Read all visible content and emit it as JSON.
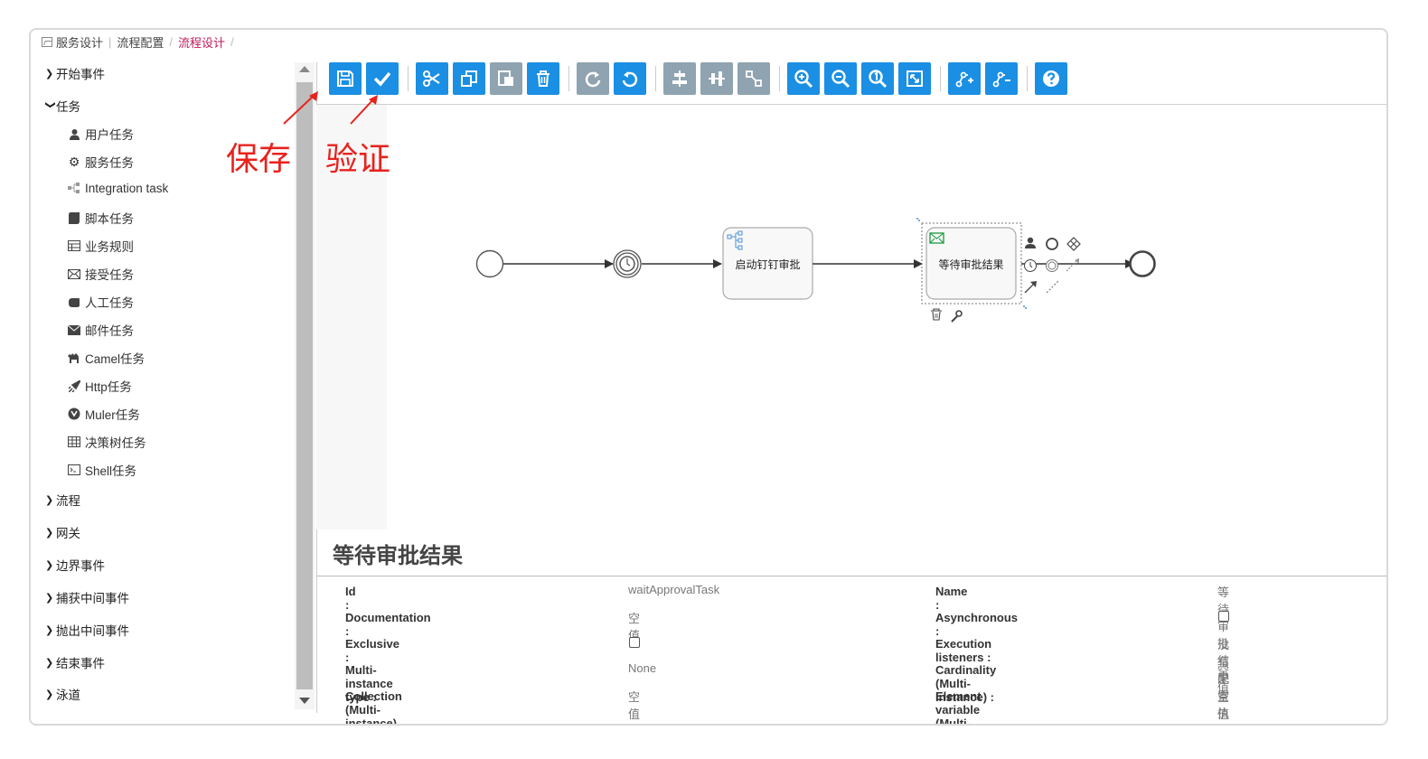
{
  "breadcrumb": {
    "items": [
      "服务设计",
      "流程配置",
      "流程设计"
    ],
    "trailing_sep": "/"
  },
  "palette": {
    "groups": [
      {
        "label": "开始事件",
        "expanded": false
      },
      {
        "label": "任务",
        "expanded": true
      },
      {
        "label": "流程",
        "expanded": false
      },
      {
        "label": "网关",
        "expanded": false
      },
      {
        "label": "边界事件",
        "expanded": false
      },
      {
        "label": "捕获中间事件",
        "expanded": false
      },
      {
        "label": "抛出中间事件",
        "expanded": false
      },
      {
        "label": "结束事件",
        "expanded": false
      },
      {
        "label": "泳道",
        "expanded": false
      }
    ],
    "task_items": [
      {
        "label": "用户任务",
        "icon": "user-icon"
      },
      {
        "label": "服务任务",
        "icon": "gear-icon"
      },
      {
        "label": "Integration task",
        "icon": "integration-icon"
      },
      {
        "label": "脚本任务",
        "icon": "script-icon"
      },
      {
        "label": "业务规则",
        "icon": "table-icon"
      },
      {
        "label": "接受任务",
        "icon": "envelope-icon"
      },
      {
        "label": "人工任务",
        "icon": "hand-icon"
      },
      {
        "label": "邮件任务",
        "icon": "mail-icon"
      },
      {
        "label": "Camel任务",
        "icon": "camel-icon"
      },
      {
        "label": "Http任务",
        "icon": "rocket-icon"
      },
      {
        "label": "Muler任务",
        "icon": "mule-icon"
      },
      {
        "label": "决策树任务",
        "icon": "grid-icon"
      },
      {
        "label": "Shell任务",
        "icon": "terminal-icon"
      }
    ]
  },
  "toolbar": {
    "buttons": [
      "save",
      "validate",
      "cut",
      "copy",
      "paste",
      "delete",
      "redo",
      "undo",
      "align-horizontal",
      "align-vertical",
      "same-size",
      "zoom-in",
      "zoom-out",
      "zoom-actual",
      "zoom-fit",
      "bendpoint-add",
      "bendpoint-remove",
      "help"
    ]
  },
  "annotations": {
    "save": "保存",
    "validate": "验证"
  },
  "diagram": {
    "task1_label": "启动钉钉审批",
    "task2_label": "等待审批结果"
  },
  "properties": {
    "title": "等待审批结果",
    "left": [
      {
        "label": "Id :",
        "value": "waitApprovalTask"
      },
      {
        "label": "Documentation :",
        "value": "空值"
      },
      {
        "label": "Exclusive :",
        "value": ""
      },
      {
        "label": "Multi-instance type :",
        "value": "None"
      },
      {
        "label": "Collection (Multi-instance) :",
        "value": "空值"
      }
    ],
    "right": [
      {
        "label": "Name :",
        "value": "等待审批结果"
      },
      {
        "label": "Asynchronous :",
        "value": ""
      },
      {
        "label": "Execution listeners :",
        "value": "没有配置执行监听器"
      },
      {
        "label": "Cardinality (Multi-instance) :",
        "value": "空值"
      },
      {
        "label": "Element variable (Multi-instance) :",
        "value": "空值"
      }
    ]
  },
  "colors": {
    "accent": "#1a8fe3",
    "annotation": "#e8221d",
    "breadcrumb_current": "#c2185b"
  }
}
